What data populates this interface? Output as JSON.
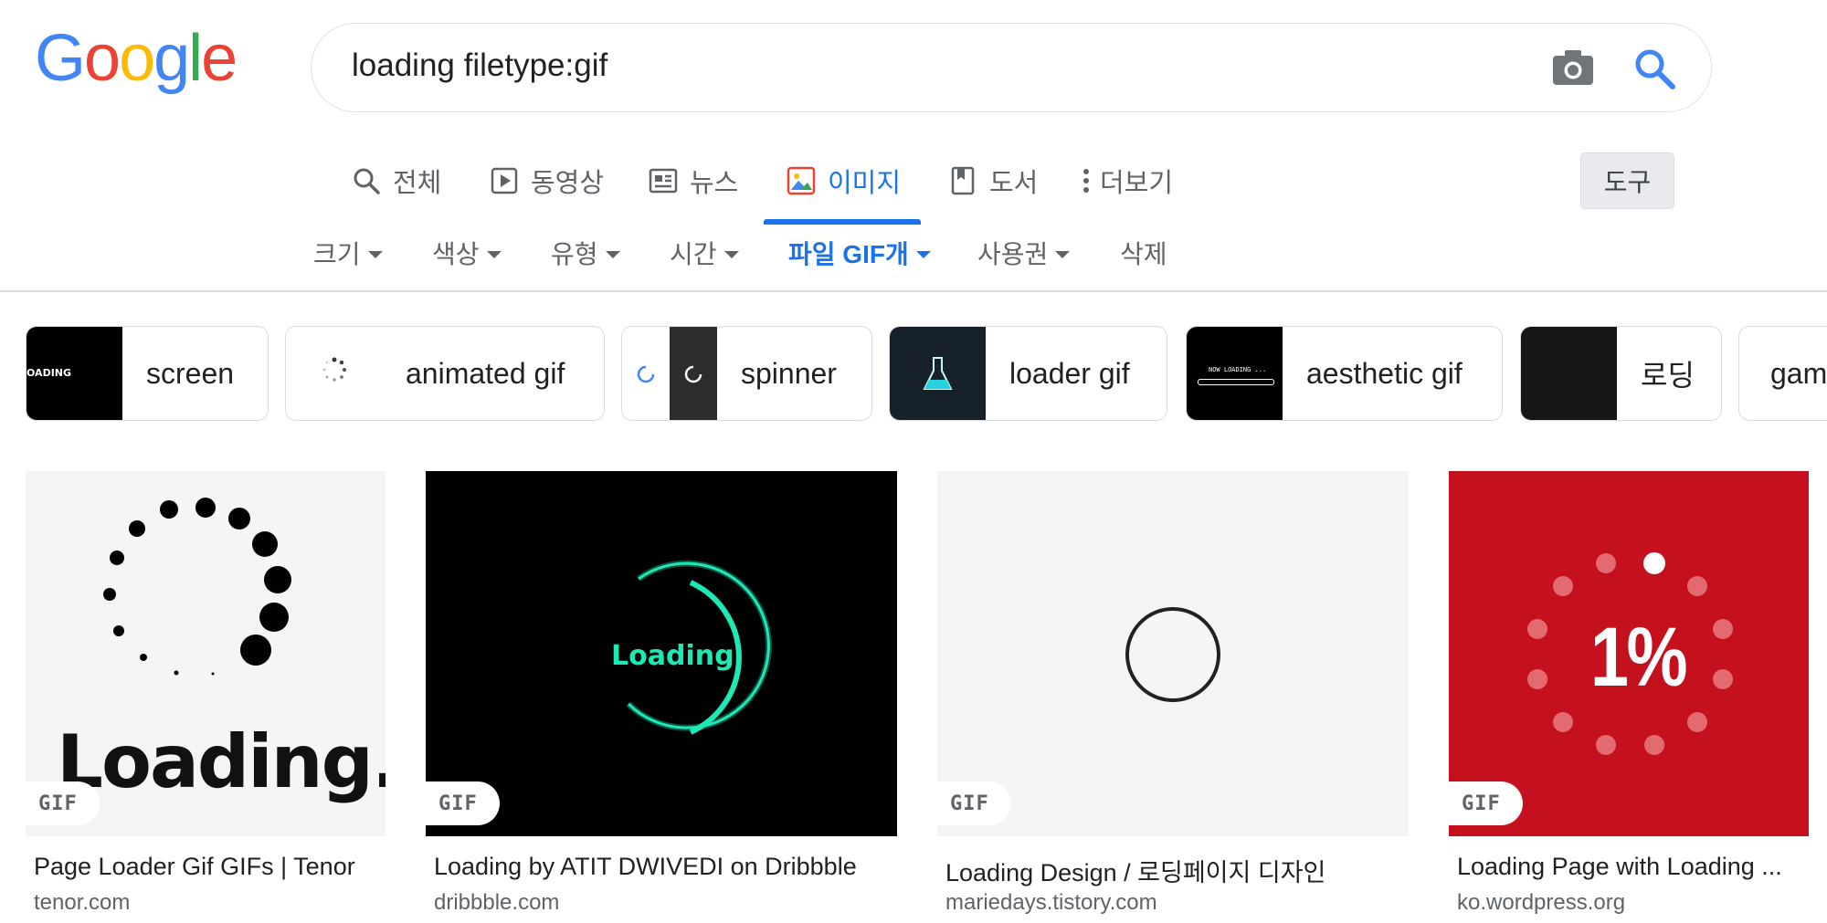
{
  "logo": {
    "letters": [
      "G",
      "o",
      "o",
      "g",
      "l",
      "e"
    ],
    "colors": [
      "#4285F4",
      "#EA4335",
      "#FBBC05",
      "#4285F4",
      "#34A853",
      "#EA4335"
    ]
  },
  "search": {
    "query": "loading filetype:gif",
    "camera_icon": "camera-icon",
    "search_icon": "search-icon"
  },
  "tabs": [
    {
      "label": "전체",
      "icon": "search-icon",
      "active": false
    },
    {
      "label": "동영상",
      "icon": "play-icon",
      "active": false
    },
    {
      "label": "뉴스",
      "icon": "news-icon",
      "active": false
    },
    {
      "label": "이미지",
      "icon": "image-icon",
      "active": true
    },
    {
      "label": "도서",
      "icon": "book-icon",
      "active": false
    },
    {
      "label": "더보기",
      "icon": "more-icon",
      "active": false
    }
  ],
  "tools": {
    "label": "도구"
  },
  "filters": [
    {
      "label": "크기",
      "active": false
    },
    {
      "label": "색상",
      "active": false
    },
    {
      "label": "유형",
      "active": false
    },
    {
      "label": "시간",
      "active": false
    },
    {
      "label": "파일 GIF개",
      "active": true
    },
    {
      "label": "사용권",
      "active": false
    },
    {
      "label": "삭제",
      "active": false
    }
  ],
  "chips": [
    {
      "label": "screen",
      "thumb_text": "OADING"
    },
    {
      "label": "animated gif"
    },
    {
      "label": "spinner"
    },
    {
      "label": "loader gif"
    },
    {
      "label": "aesthetic gif",
      "thumb_text": "NOW LOADING ..."
    },
    {
      "label": "로딩"
    },
    {
      "label": "gam"
    }
  ],
  "results": [
    {
      "title": "Page Loader Gif GIFs | Tenor",
      "source": "tenor.com",
      "badge": "GIF",
      "image_text": "Loading..."
    },
    {
      "title": "Loading by ATIT DWIVEDI on Dribbble",
      "source": "dribbble.com",
      "badge": "GIF",
      "image_text": "Loading"
    },
    {
      "title": "Loading Design / 로딩페이지 디자인",
      "source": "mariedays.tistory.com",
      "badge": "GIF"
    },
    {
      "title": "Loading Page with Loading ...",
      "source": "ko.wordpress.org",
      "badge": "GIF",
      "image_text": "1%"
    }
  ],
  "colors": {
    "accent": "#1a73e8",
    "text": "#202124",
    "muted": "#5f6368",
    "border": "#dadce0",
    "teal": "#1de9b6",
    "red": "#c5101e"
  }
}
